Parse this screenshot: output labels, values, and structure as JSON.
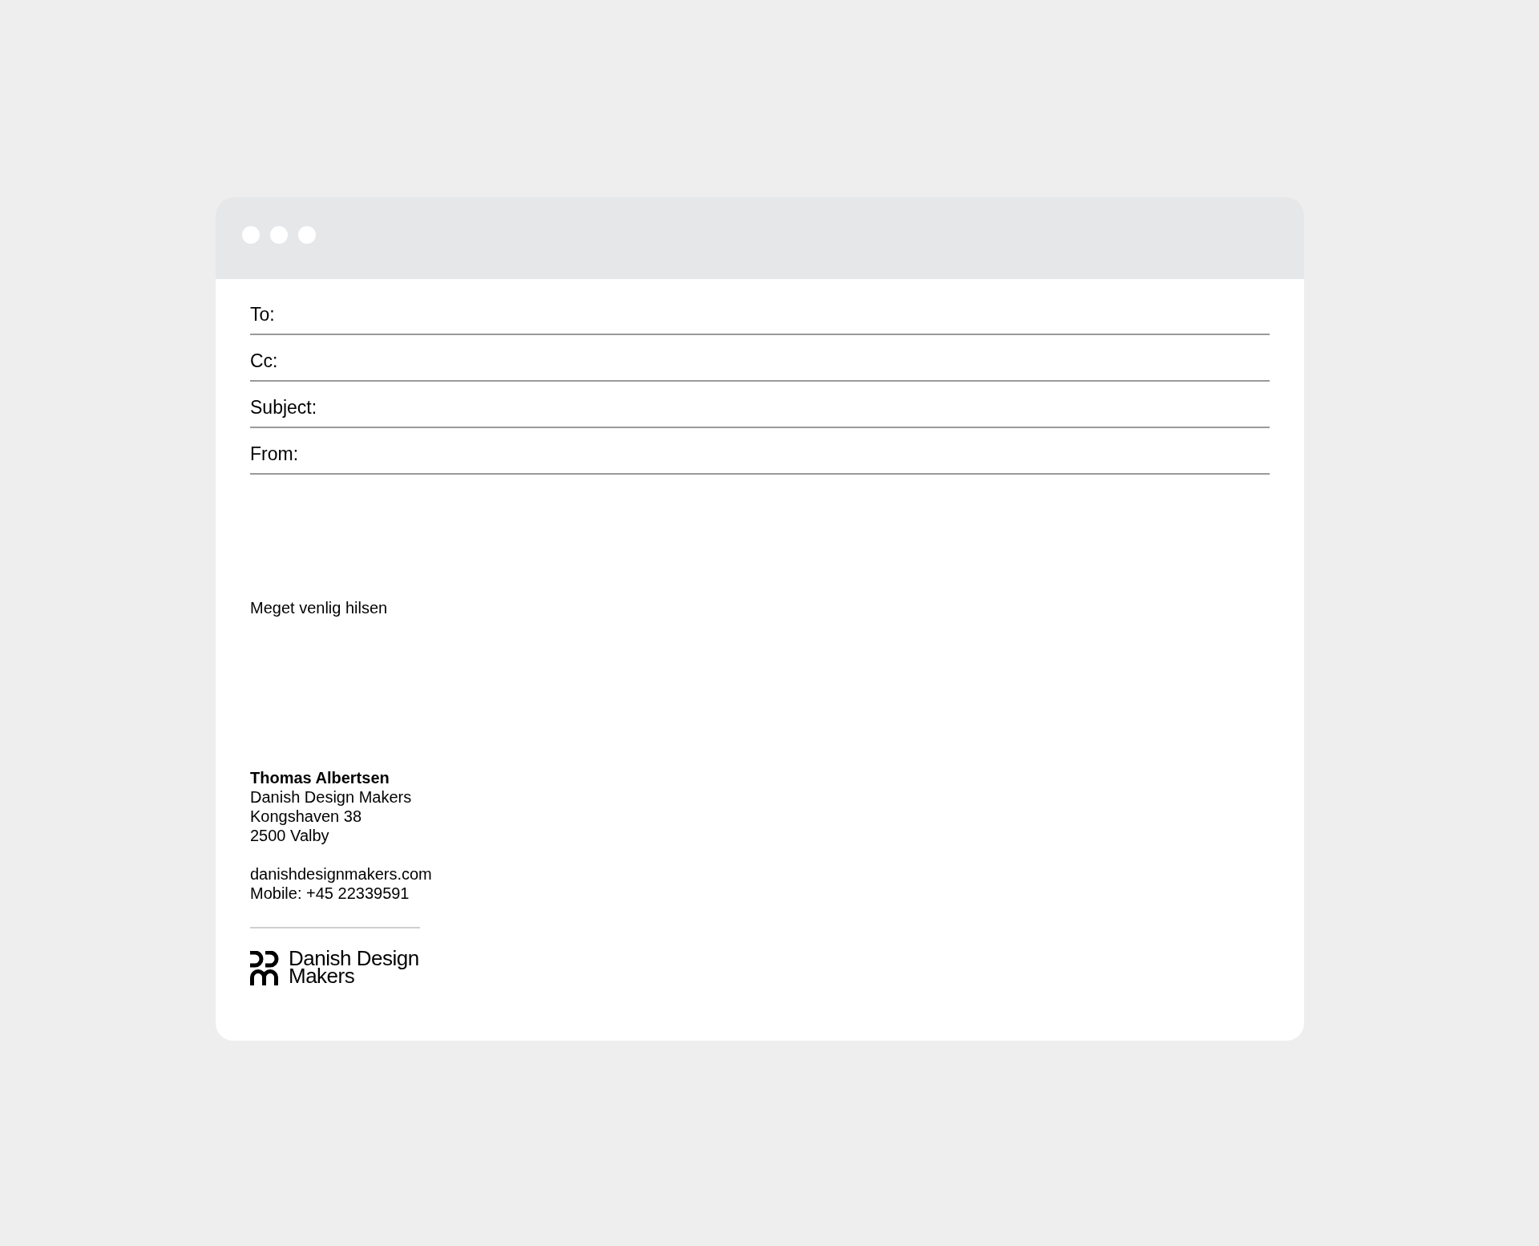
{
  "window": {
    "controls": [
      {
        "kind": "dot"
      },
      {
        "kind": "dot"
      },
      {
        "kind": "dot"
      }
    ]
  },
  "fields": [
    {
      "label": "To:"
    },
    {
      "label": "Cc:"
    },
    {
      "label": "Subject:"
    },
    {
      "label": "From:"
    }
  ],
  "body": {
    "greeting": "Meget venlig hilsen"
  },
  "signature": {
    "name": "Thomas Albertsen",
    "address": [
      "Danish Design Makers",
      "Kongshaven 38",
      "2500 Valby"
    ],
    "contact": [
      "danishdesignmakers.com",
      "Mobile: +45 22339591"
    ]
  },
  "logo": {
    "text": "Danish Design Makers"
  }
}
